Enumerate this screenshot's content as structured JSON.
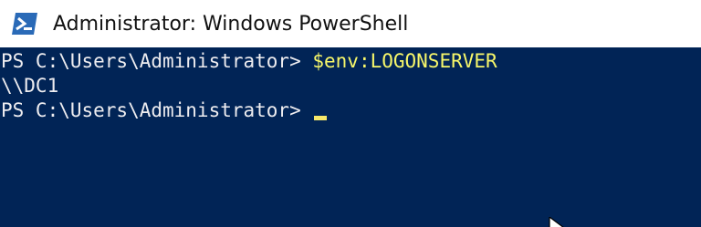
{
  "window": {
    "title": "Administrator: Windows PowerShell",
    "icon": "powershell-icon"
  },
  "console": {
    "colors": {
      "background": "#012456",
      "text": "#eeedf0",
      "command": "#f7f76a"
    },
    "lines": [
      {
        "prompt": "PS C:\\Users\\Administrator> ",
        "command": "$env:LOGONSERVER"
      },
      {
        "output": "\\\\DC1"
      },
      {
        "prompt": "PS C:\\Users\\Administrator> ",
        "command": ""
      }
    ]
  },
  "mouse_pointer": "arrow-cursor-icon"
}
